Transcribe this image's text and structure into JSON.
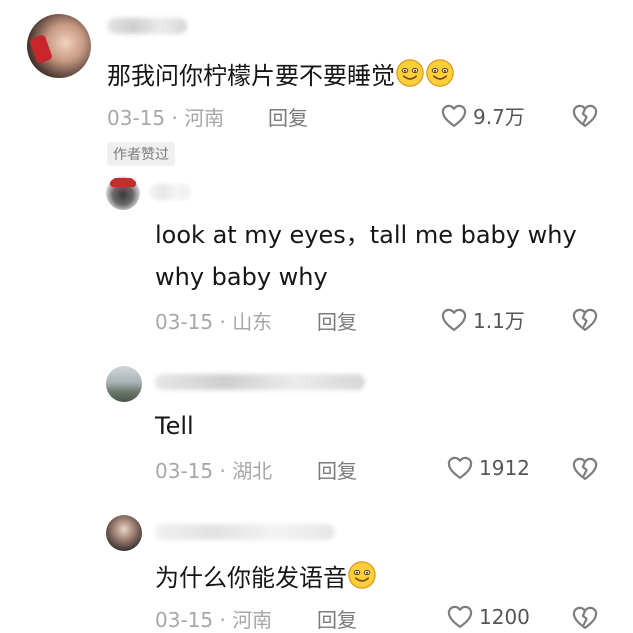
{
  "comments": [
    {
      "text": "那我问你柠檬片要不要睡觉",
      "date_location": "03-15 · 河南",
      "reply_label": "回复",
      "likes": "9.7万",
      "badge": "作者赞过"
    },
    {
      "text_line1": "look at my eyes，tall me baby why",
      "text_line2": "why baby why",
      "date_location": "03-15 · 山东",
      "reply_label": "回复",
      "likes": "1.1万"
    },
    {
      "text": "Tell",
      "date_location": "03-15 · 湖北",
      "reply_label": "回复",
      "likes": "1912"
    },
    {
      "text": "为什么你能发语音",
      "date_location": "03-15 · 河南",
      "reply_label": "回复",
      "likes": "1200"
    }
  ],
  "colors": {
    "text": "#161616",
    "meta": "#a7a7a7",
    "icon": "#7d7d7d"
  },
  "icons": [
    "heart-icon",
    "broken-heart-icon",
    "smile-emoji"
  ]
}
